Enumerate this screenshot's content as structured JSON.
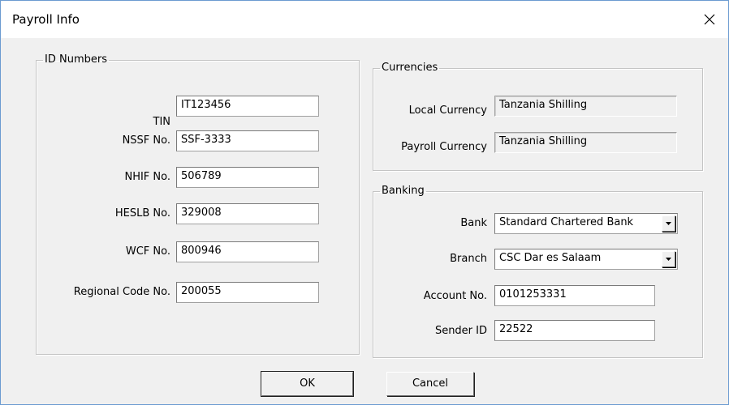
{
  "window": {
    "title": "Payroll Info"
  },
  "id_numbers": {
    "legend": "ID Numbers",
    "fields": [
      {
        "label": "TIN",
        "value": "IT123456"
      },
      {
        "label": "NSSF No.",
        "value": "SSF-3333"
      },
      {
        "label": "NHIF No.",
        "value": "506789"
      },
      {
        "label": "HESLB No.",
        "value": "329008"
      },
      {
        "label": "WCF No.",
        "value": "800946"
      },
      {
        "label": "Regional Code No.",
        "value": "200055"
      }
    ]
  },
  "currencies": {
    "legend": "Currencies",
    "local_label": "Local Currency",
    "local_value": "Tanzania Shilling",
    "payroll_label": "Payroll Currency",
    "payroll_value": "Tanzania Shilling"
  },
  "banking": {
    "legend": "Banking",
    "bank_label": "Bank",
    "bank_value": "Standard Chartered Bank",
    "branch_label": "Branch",
    "branch_value": "CSC Dar es Salaam",
    "account_label": "Account No.",
    "account_value": "0101253331",
    "sender_label": "Sender ID",
    "sender_value": "22522"
  },
  "buttons": {
    "ok": "OK",
    "cancel": "Cancel"
  },
  "colors": {
    "window_border": "#6b9bd1",
    "dialog_bg": "#f0f0f0"
  }
}
